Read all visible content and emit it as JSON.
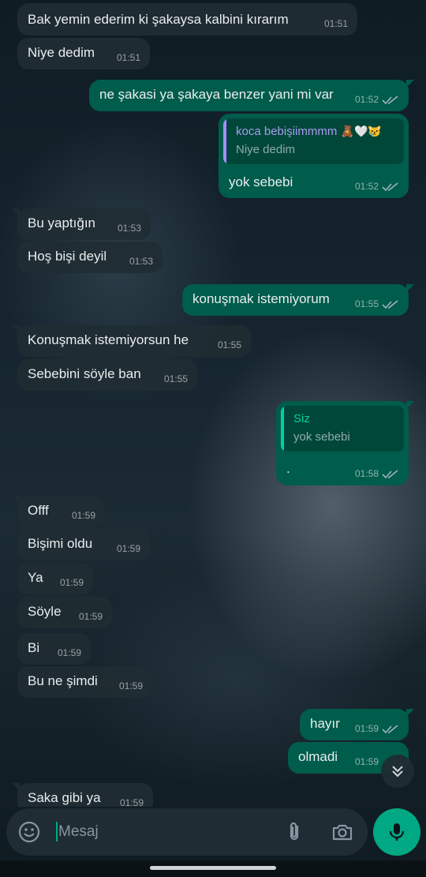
{
  "colors": {
    "incoming_bubble": "#202c33",
    "outgoing_bubble": "#005c4b",
    "accent": "#00a884",
    "read_ticks": "#9fb4bf"
  },
  "messages": [
    {
      "dir": "in",
      "text": "Bak yemin ederim ki şakaysa kalbini kırarım",
      "time": "01:51"
    },
    {
      "dir": "in",
      "text": "Niye dedim",
      "time": "01:51"
    },
    {
      "dir": "out",
      "text": "ne şakasi ya şakaya benzer yani mi var",
      "time": "01:52"
    },
    {
      "dir": "out",
      "quote_author": "koca bebişiimmmm",
      "quote_emoji": "🧸🤍😿",
      "quote_text": "Niye dedim",
      "text": "yok sebebi",
      "time": "01:52"
    },
    {
      "dir": "in",
      "text": "Bu yaptığın",
      "time": "01:53"
    },
    {
      "dir": "in",
      "text": "Hoş bişi deyil",
      "time": "01:53"
    },
    {
      "dir": "out",
      "text": "konuşmak istemiyorum",
      "time": "01:55"
    },
    {
      "dir": "in",
      "text": "Konuşmak istemiyorsun he",
      "time": "01:55"
    },
    {
      "dir": "in",
      "text": "Sebebini söyle ban",
      "time": "01:55"
    },
    {
      "dir": "out",
      "quote_author": "Siz",
      "quote_text": "yok sebebi",
      "text": ".",
      "time": "01:58"
    },
    {
      "dir": "in",
      "text": "Offf",
      "time": "01:59"
    },
    {
      "dir": "in",
      "text": "Bişimi oldu",
      "time": "01:59"
    },
    {
      "dir": "in",
      "text": "Ya",
      "time": "01:59"
    },
    {
      "dir": "in",
      "text": "Söyle",
      "time": "01:59"
    },
    {
      "dir": "in",
      "text": "Bi",
      "time": "01:59"
    },
    {
      "dir": "in",
      "text": "Bu ne şimdi",
      "time": "01:59"
    },
    {
      "dir": "out",
      "text": "hayır",
      "time": "01:59"
    },
    {
      "dir": "out",
      "text": "olmadi",
      "time": "01:59"
    },
    {
      "dir": "in",
      "text": "Saka gibi ya",
      "time": "01:59"
    }
  ],
  "composer": {
    "placeholder": "Mesaj",
    "emoji_icon": "emoji-icon",
    "attach_icon": "paperclip-icon",
    "camera_icon": "camera-icon",
    "mic_icon": "microphone-icon"
  },
  "scroll_down_icon": "double-chevron-down-icon"
}
